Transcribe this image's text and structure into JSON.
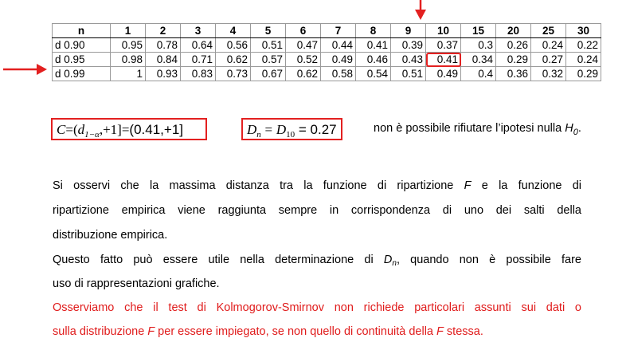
{
  "table": {
    "header": [
      "n",
      "1",
      "2",
      "3",
      "4",
      "5",
      "6",
      "7",
      "8",
      "9",
      "10",
      "15",
      "20",
      "25",
      "30"
    ],
    "rows": [
      {
        "label": "d 0.90",
        "values": [
          "0.95",
          "0.78",
          "0.64",
          "0.56",
          "0.51",
          "0.47",
          "0.44",
          "0.41",
          "0.39",
          "0.37",
          "0.3",
          "0.26",
          "0.24",
          "0.22"
        ]
      },
      {
        "label": "d 0.95",
        "values": [
          "0.98",
          "0.84",
          "0.71",
          "0.62",
          "0.57",
          "0.52",
          "0.49",
          "0.46",
          "0.43",
          "0.41",
          "0.34",
          "0.29",
          "0.27",
          "0.24"
        ]
      },
      {
        "label": "d 0.99",
        "values": [
          "1",
          "0.93",
          "0.83",
          "0.73",
          "0.67",
          "0.62",
          "0.58",
          "0.54",
          "0.51",
          "0.49",
          "0.4",
          "0.36",
          "0.32",
          "0.29"
        ]
      }
    ],
    "highlight": {
      "row": "d 0.95",
      "column": "10",
      "value": "0.41"
    }
  },
  "formula1": {
    "lhs": "C",
    "eq1": "=",
    "open": "(",
    "d": "d",
    "d_sub": "1−α",
    "comma_one": ",+1",
    "close": "]",
    "eq2": "=",
    "interval": "(0.41,+1]"
  },
  "formula2": {
    "dn": "D",
    "dn_sub": "n",
    "eq1": "=",
    "d10": "D",
    "d10_sub": "10",
    "value": "= 0.27"
  },
  "conclusion": {
    "text": "non è possibile rifiutare l’ipotesi nulla ",
    "h": "H",
    "h_sub": "0",
    "end": "."
  },
  "paragraph": {
    "line1a": "Si osservi che la massima distanza tra la funzione di ripartizione ",
    "line1_F": "F",
    "line1b": " e la funzione di",
    "line2": "ripartizione empirica viene raggiunta sempre in corrispondenza di uno dei salti della",
    "line3": "distribuzione empirica.",
    "line4a": "Questo fatto può essere utile nella determinazione di ",
    "line4_D": "D",
    "line4_sub": "n",
    "line4b": ", quando non è possibile fare",
    "line5": "uso di rappresentazioni grafiche.",
    "red1": "Osserviamo che il test di Kolmogorov-Smirnov non richiede particolari assunti sui dati o",
    "red2a": "sulla distribuzione ",
    "red2_F1": "F",
    "red2b": " per essere impiegato, se non quello di continuità della ",
    "red2_F2": "F",
    "red2c": " stessa."
  },
  "colors": {
    "highlight": "#e32020",
    "red_text": "#e01b1b"
  }
}
